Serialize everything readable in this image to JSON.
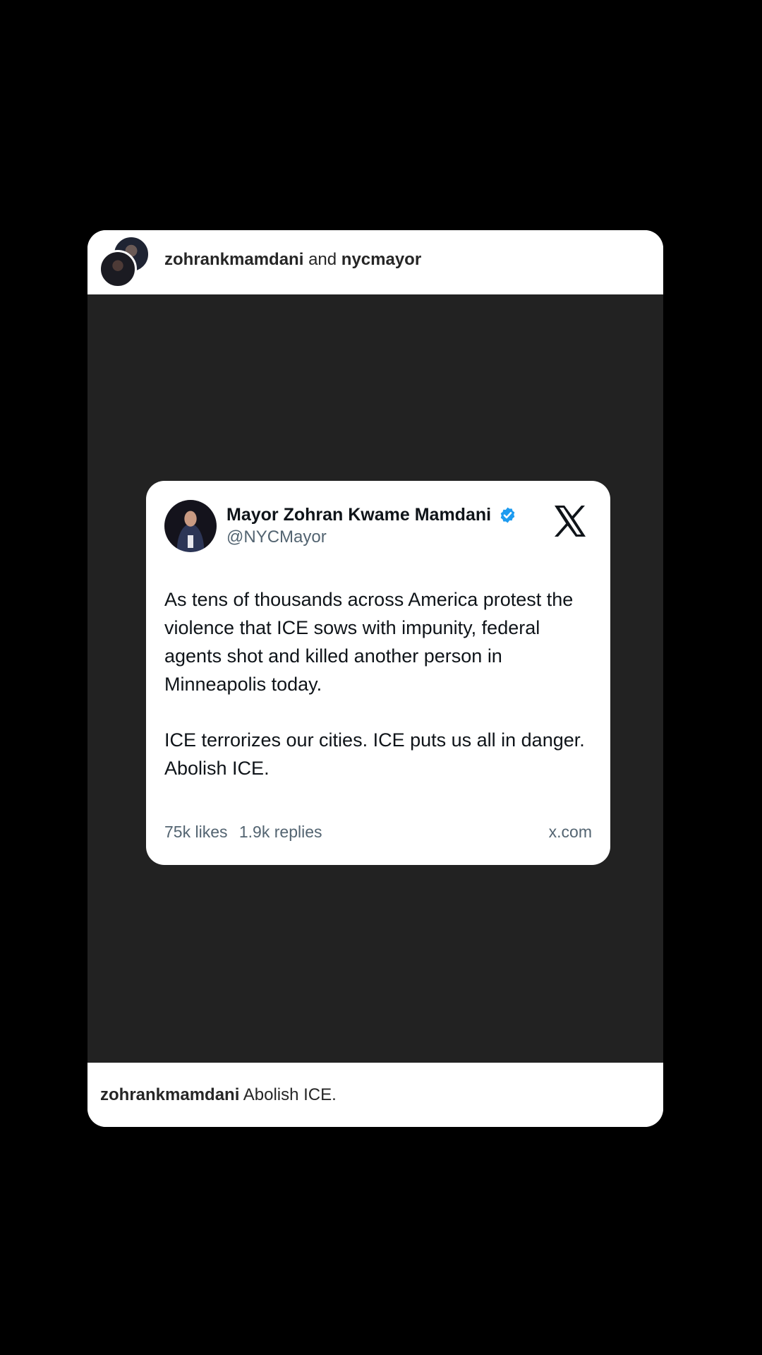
{
  "post": {
    "header": {
      "author": "zohrankmamdani",
      "connector": "and",
      "coauthor": "nycmayor"
    },
    "tweet": {
      "display_name": "Mayor Zohran Kwame Mamdani",
      "handle": "@NYCMayor",
      "verified_color": "#1d9bf0",
      "paragraphs": [
        "As tens of thousands across America protest the violence that ICE sows with impunity, federal agents shot and killed another person in Minneapolis today.",
        "ICE terrorizes our cities. ICE puts us all in danger. Abolish ICE."
      ],
      "likes": "75k likes",
      "replies": "1.9k replies",
      "source": "x.com"
    },
    "caption": {
      "username": "zohrankmamdani",
      "text": " Abolish ICE."
    }
  },
  "colors": {
    "page_background": "#000000",
    "media_background": "#222222",
    "card_background": "#ffffff"
  }
}
